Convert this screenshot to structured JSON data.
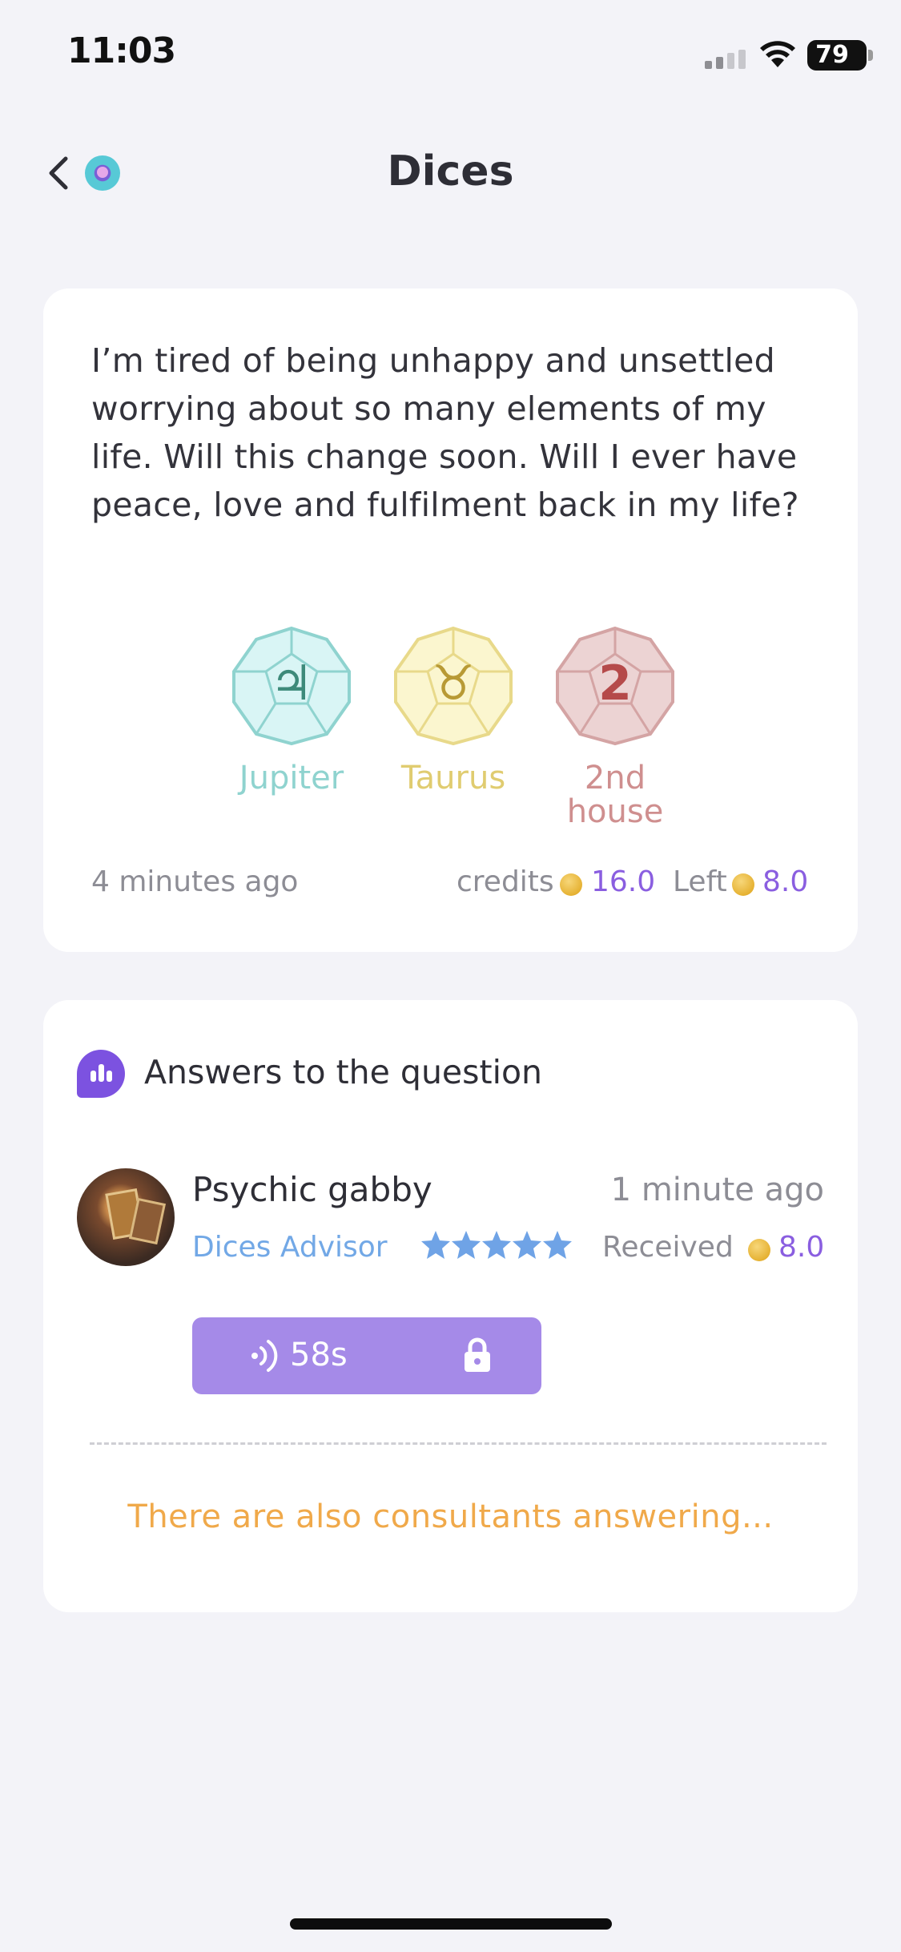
{
  "status_bar": {
    "time": "11:03",
    "battery": "79"
  },
  "header": {
    "title": "Dices"
  },
  "question": {
    "text": "I’m tired of being unhappy and unsettled worrying about so many elements of my life.  Will this change soon.  Will I ever have peace, love and fulfilment back in my life?",
    "dice": [
      {
        "symbol": "♃",
        "label": "Jupiter",
        "color": "#8fd3cf",
        "fill": "#d9f5f5",
        "symbol_color": "#3d8a7a"
      },
      {
        "symbol": "♉",
        "label": "Taurus",
        "color": "#e8d98a",
        "fill": "#fbf6cf",
        "symbol_color": "#b89a35"
      },
      {
        "symbol": "2",
        "label": "2nd\nhouse",
        "color": "#d4a4a4",
        "fill": "#ecd3d3",
        "symbol_color": "#b54a4a"
      }
    ],
    "time_ago": "4 minutes ago",
    "credits_label": "credits",
    "credits_value": "16.0",
    "left_label": "Left",
    "left_value": "8.0"
  },
  "answers": {
    "title": "Answers to the question",
    "items": [
      {
        "advisor_name": "Psychic gabby",
        "time_ago": "1 minute ago",
        "role": "Dices Advisor",
        "rating": 5,
        "received_label": "Received",
        "received_value": "8.0",
        "voice_duration": "58s"
      }
    ],
    "pending_text": "There are also consultants answering..."
  },
  "colors": {
    "accent_purple": "#8a5ee0",
    "voice_button": "#a58ae8",
    "role_blue": "#72a8e6",
    "pending_orange": "#f0a94a"
  }
}
